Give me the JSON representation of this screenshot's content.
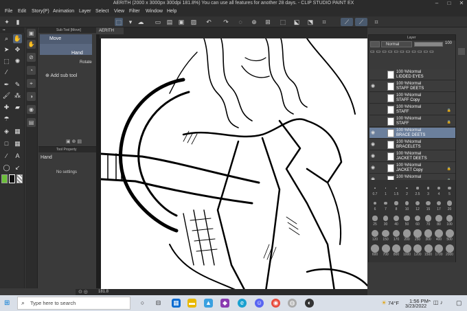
{
  "window": {
    "title": "AERITH (2000 x 3000px 300dpi 181.8%)  You can use all features for another 28 days.  - CLIP STUDIO PAINT EX"
  },
  "menu": [
    "File",
    "Edit",
    "Story(P)",
    "Animation",
    "Layer",
    "Select",
    "View",
    "Filter",
    "Window",
    "Help"
  ],
  "subtool_panel": {
    "header": "Sub Tool [Move]",
    "items": [
      {
        "label": "Move",
        "selected": false
      },
      {
        "label": "Hand",
        "selected": true
      },
      {
        "label": "Rotate",
        "selected": false
      }
    ],
    "add_label": "Add sub tool"
  },
  "tool_property": {
    "header": "Tool Property",
    "tool_name": "Hand",
    "empty_text": "No settings"
  },
  "canvas": {
    "tab_label": "AERITH",
    "zoom": "181.8"
  },
  "layer_panel": {
    "header": "Layer",
    "blend_mode": "Normal",
    "opacity": "100",
    "layers": [
      {
        "opacity_mode": "100 %Normal",
        "name": "LIDDED EYES",
        "visible": false,
        "selected": false,
        "locked": false
      },
      {
        "opacity_mode": "100 %Normal",
        "name": "STAFF DEETS",
        "visible": true,
        "selected": false,
        "locked": false
      },
      {
        "opacity_mode": "100 %Normal",
        "name": "STAFF Copy",
        "visible": false,
        "selected": false,
        "locked": false
      },
      {
        "opacity_mode": "100 %Normal",
        "name": "STAFF",
        "visible": false,
        "selected": false,
        "locked": true
      },
      {
        "opacity_mode": "100 %Normal",
        "name": "STAFF",
        "visible": false,
        "selected": false,
        "locked": true
      },
      {
        "opacity_mode": "100 %Normal",
        "name": "BRACE DEETS",
        "visible": true,
        "selected": true,
        "locked": false
      },
      {
        "opacity_mode": "100 %Normal",
        "name": "BRACELETS",
        "visible": true,
        "selected": false,
        "locked": false
      },
      {
        "opacity_mode": "100 %Normal",
        "name": "JACKET DEETS",
        "visible": true,
        "selected": false,
        "locked": false
      },
      {
        "opacity_mode": "100 %Normal",
        "name": "JACKET Copy",
        "visible": true,
        "selected": false,
        "locked": true
      },
      {
        "opacity_mode": "100 %Normal",
        "name": "",
        "visible": true,
        "selected": false,
        "locked": true
      }
    ]
  },
  "brush_sizes": [
    "0.7",
    "1",
    "1.5",
    "2",
    "2.5",
    "3",
    "4",
    "5",
    "6",
    "7",
    "8",
    "10",
    "12",
    "15",
    "17",
    "20",
    "25",
    "30",
    "40",
    "50",
    "60",
    "70",
    "80",
    "100",
    "120",
    "150",
    "170",
    "200",
    "250",
    "300",
    "400",
    "500",
    "600",
    "700",
    "800",
    "1000",
    "1200",
    "1500",
    "1700",
    "2000"
  ],
  "taskbar": {
    "search_placeholder": "Type here to search",
    "weather": "74°F",
    "time": "1:56 PM",
    "date": "3/23/2022"
  },
  "colors": {
    "main_color": "#6cbf3a",
    "sub_color": "#ffffff",
    "selection": "#6b7f9c"
  }
}
